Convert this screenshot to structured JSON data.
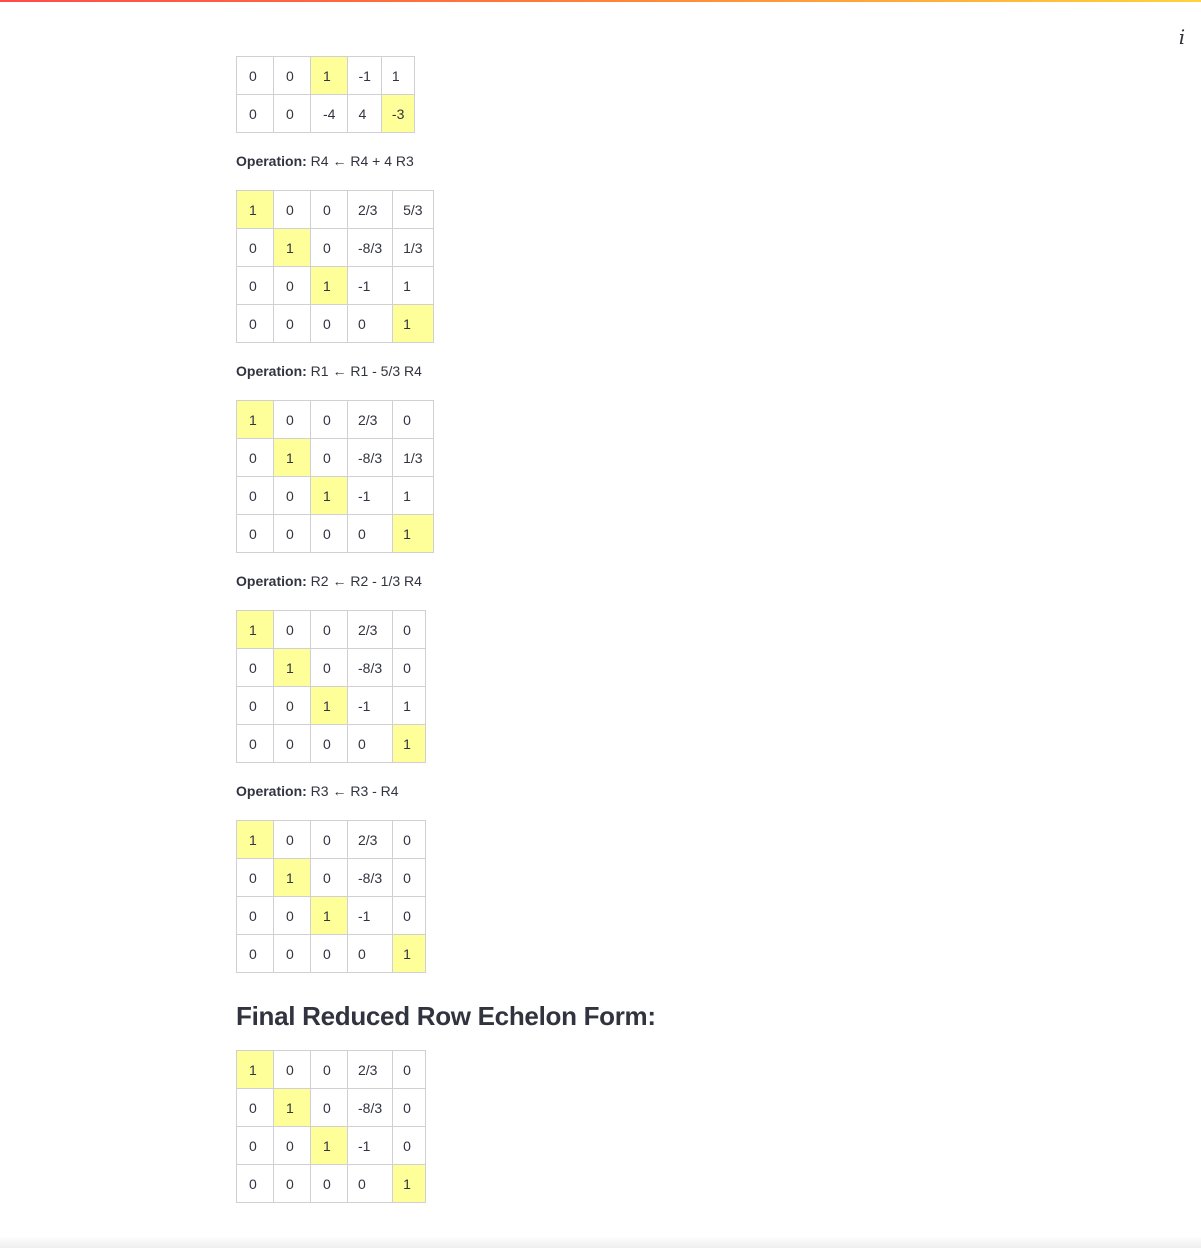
{
  "info_icon": "i",
  "partial_matrix": [
    [
      "0",
      "0",
      "1",
      "-1",
      "1"
    ],
    [
      "0",
      "0",
      "-4",
      "4",
      "-3"
    ]
  ],
  "partial_pivots": [
    [
      0,
      2
    ],
    [
      1,
      4
    ]
  ],
  "steps": [
    {
      "label_prefix": "Operation:",
      "operation": "R4 ← R4 + 4 R3",
      "matrix": [
        [
          "1",
          "0",
          "0",
          "2/3",
          "5/3"
        ],
        [
          "0",
          "1",
          "0",
          "-8/3",
          "1/3"
        ],
        [
          "0",
          "0",
          "1",
          "-1",
          "1"
        ],
        [
          "0",
          "0",
          "0",
          "0",
          "1"
        ]
      ]
    },
    {
      "label_prefix": "Operation:",
      "operation": "R1 ← R1 - 5/3 R4",
      "matrix": [
        [
          "1",
          "0",
          "0",
          "2/3",
          "0"
        ],
        [
          "0",
          "1",
          "0",
          "-8/3",
          "1/3"
        ],
        [
          "0",
          "0",
          "1",
          "-1",
          "1"
        ],
        [
          "0",
          "0",
          "0",
          "0",
          "1"
        ]
      ]
    },
    {
      "label_prefix": "Operation:",
      "operation": "R2 ← R2 - 1/3 R4",
      "matrix": [
        [
          "1",
          "0",
          "0",
          "2/3",
          "0"
        ],
        [
          "0",
          "1",
          "0",
          "-8/3",
          "0"
        ],
        [
          "0",
          "0",
          "1",
          "-1",
          "1"
        ],
        [
          "0",
          "0",
          "0",
          "0",
          "1"
        ]
      ]
    },
    {
      "label_prefix": "Operation:",
      "operation": "R3 ← R3 - R4",
      "matrix": [
        [
          "1",
          "0",
          "0",
          "2/3",
          "0"
        ],
        [
          "0",
          "1",
          "0",
          "-8/3",
          "0"
        ],
        [
          "0",
          "0",
          "1",
          "-1",
          "0"
        ],
        [
          "0",
          "0",
          "0",
          "0",
          "1"
        ]
      ]
    }
  ],
  "final": {
    "heading": "Final Reduced Row Echelon Form:",
    "matrix": [
      [
        "1",
        "0",
        "0",
        "2/3",
        "0"
      ],
      [
        "0",
        "1",
        "0",
        "-8/3",
        "0"
      ],
      [
        "0",
        "0",
        "1",
        "-1",
        "0"
      ],
      [
        "0",
        "0",
        "0",
        "0",
        "1"
      ]
    ]
  },
  "pivot_cells": [
    [
      0,
      0
    ],
    [
      1,
      1
    ],
    [
      2,
      2
    ],
    [
      3,
      4
    ]
  ],
  "colors": {
    "pivot": "#ffff99",
    "border": "#d0d0d4",
    "text": "#31333f"
  }
}
